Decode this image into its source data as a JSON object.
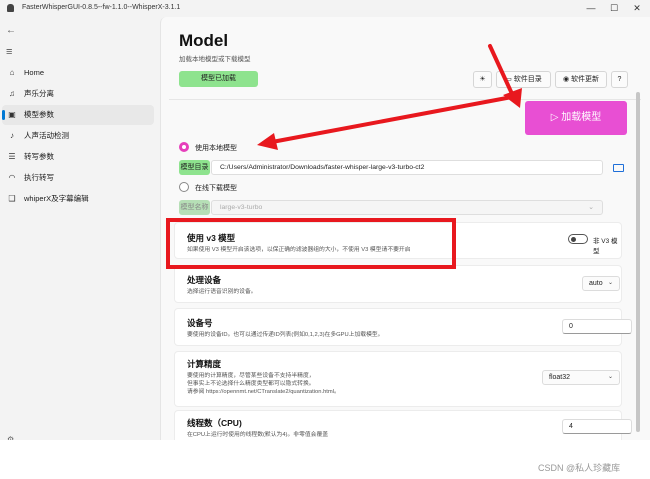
{
  "window": {
    "title": "FasterWhisperGUI-0.8.5--fw-1.1.0--WhisperX-3.1.1",
    "controls": {
      "minimize": "—",
      "maximize": "☐",
      "close": "✕"
    }
  },
  "sidebar": {
    "back_glyph": "←",
    "menu_glyph": "≡",
    "items": [
      {
        "label": "Home",
        "icon": "home-icon",
        "glyph": "⌂"
      },
      {
        "label": "声乐分离",
        "icon": "vocal-separation-icon",
        "glyph": "♫"
      },
      {
        "label": "模型参数",
        "icon": "model-icon",
        "glyph": "▣",
        "active": true
      },
      {
        "label": "人声活动检测",
        "icon": "voice-activity-icon",
        "glyph": "♪"
      },
      {
        "label": "转写参数",
        "icon": "transcribe-params-icon",
        "glyph": "☰"
      },
      {
        "label": "执行转写",
        "icon": "headphones-icon",
        "glyph": "◠"
      },
      {
        "label": "whiperX及字幕编辑",
        "icon": "subtitle-edit-icon",
        "glyph": "❑"
      }
    ],
    "settings_glyph": "⚙"
  },
  "page": {
    "title": "Model",
    "subtitle": "加载本地模型或下载模型",
    "model_loaded_label": "模型已加载",
    "toolbar": {
      "theme_icon": "sun-icon",
      "theme_glyph": "☀",
      "software_dir_label": "软件目录",
      "software_dir_glyph": "▭",
      "update_label": "软件更新",
      "update_glyph": "◉",
      "help_label": "?"
    },
    "load_model_label": "加载模型",
    "load_model_glyph": "▷",
    "local_model_option": "使用本地模型",
    "model_dir_label": "模型目录",
    "model_dir_value": "C:/Users/Administrator/Downloads/faster-whisper-large-v3-turbo-ct2",
    "online_model_option": "在线下载模型",
    "model_name_label": "模型名称",
    "model_name_value": "large-v3-turbo",
    "chevron": "⌄"
  },
  "settings": {
    "v3": {
      "title": "使用 v3 模型",
      "desc": "如果使用 V3 模型开启该选项，以保正确的滤波器组的大小，不使用 V3 模型请不要开启",
      "toggle_label": "非 V3 模型",
      "enabled": false
    },
    "device": {
      "title": "处理设备",
      "desc": "选择运行语音识别的设备。",
      "value": "auto"
    },
    "device_id": {
      "title": "设备号",
      "desc": "要使用的设备ID。也可以通过传递ID列表(例如0,1,2,3)在多GPU上加载模型。",
      "value": "0"
    },
    "precision": {
      "title": "计算精度",
      "desc_lines": [
        "要使用的计算精度，尽管某些设备不支持半精度，",
        "但事实上不论选择什么精度类型都可以隐式转换。",
        "请参阅 https://opennmt.net/CTranslate2/quantization.html。"
      ],
      "value": "float32"
    },
    "threads": {
      "title": "线程数（CPU)",
      "desc": "在CPU上运行时使用的线程数(默认为4)。非零值会覆盖",
      "value": "4"
    }
  },
  "watermark": "CSDN @私人珍藏库",
  "colors": {
    "accent_pink": "#e84fd3",
    "loaded_green": "#8ee38e",
    "annotation_red": "#e8181e"
  }
}
